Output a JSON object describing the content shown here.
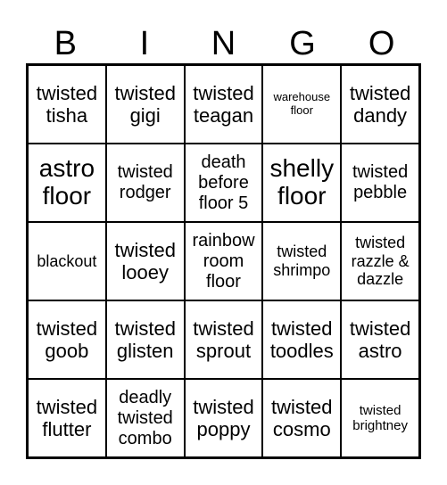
{
  "header": [
    "B",
    "I",
    "N",
    "G",
    "O"
  ],
  "rows": [
    [
      {
        "text": "twisted tisha",
        "size": "l"
      },
      {
        "text": "twisted gigi",
        "size": "l"
      },
      {
        "text": "twisted teagan",
        "size": "l"
      },
      {
        "text": "warehouse floor",
        "size": "xxs"
      },
      {
        "text": "twisted dandy",
        "size": "l"
      }
    ],
    [
      {
        "text": "astro floor",
        "size": "xl"
      },
      {
        "text": "twisted rodger",
        "size": "m"
      },
      {
        "text": "death before floor 5",
        "size": "m"
      },
      {
        "text": "shelly floor",
        "size": "xl"
      },
      {
        "text": "twisted pebble",
        "size": "m"
      }
    ],
    [
      {
        "text": "blackout",
        "size": "s"
      },
      {
        "text": "twisted looey",
        "size": "l"
      },
      {
        "text": "rainbow room floor",
        "size": "m"
      },
      {
        "text": "twisted shrimpo",
        "size": "s"
      },
      {
        "text": "twisted razzle & dazzle",
        "size": "s"
      }
    ],
    [
      {
        "text": "twisted goob",
        "size": "l"
      },
      {
        "text": "twisted glisten",
        "size": "l"
      },
      {
        "text": "twisted sprout",
        "size": "l"
      },
      {
        "text": "twisted toodles",
        "size": "l"
      },
      {
        "text": "twisted astro",
        "size": "l"
      }
    ],
    [
      {
        "text": "twisted flutter",
        "size": "l"
      },
      {
        "text": "deadly twisted combo",
        "size": "m"
      },
      {
        "text": "twisted poppy",
        "size": "l"
      },
      {
        "text": "twisted cosmo",
        "size": "l"
      },
      {
        "text": "twisted brightney",
        "size": "xs"
      }
    ]
  ]
}
